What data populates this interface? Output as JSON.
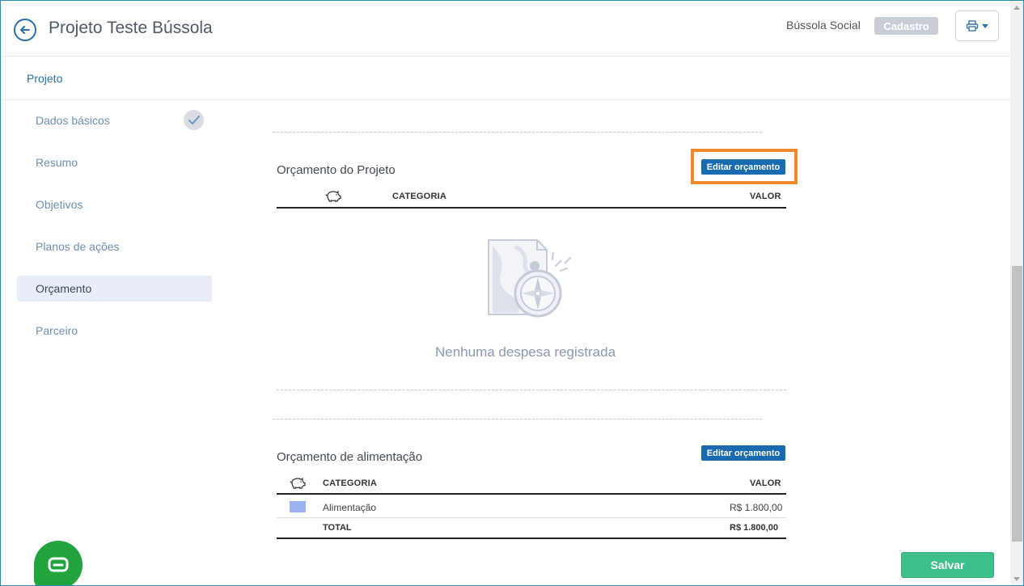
{
  "header": {
    "title": "Projeto Teste Bússola",
    "org_name": "Bússola Social",
    "status_badge": "Cadastro"
  },
  "subheader": {
    "title": "Projeto"
  },
  "sidebar": {
    "items": [
      {
        "label": "Dados básicos",
        "completed": true
      },
      {
        "label": "Resumo"
      },
      {
        "label": "Objetivos"
      },
      {
        "label": "Planos de ações"
      },
      {
        "label": "Orçamento",
        "active": true
      },
      {
        "label": "Parceiro"
      }
    ]
  },
  "budget_project": {
    "title": "Orçamento do Projeto",
    "edit_label": "Editar orçamento",
    "col_category": "CATEGORIA",
    "col_value": "VALOR",
    "empty_text": "Nenhuma despesa registrada"
  },
  "budget_food": {
    "title": "Orçamento de alimentação",
    "edit_label": "Editar orçamento",
    "col_category": "CATEGORIA",
    "col_value": "VALOR",
    "rows": [
      {
        "category": "Alimentação",
        "value": "R$ 1.800,00",
        "color": "#9db4f0"
      }
    ],
    "total_label": "TOTAL",
    "total_value": "R$ 1.800,00"
  },
  "actions": {
    "save_label": "Salvar"
  },
  "colors": {
    "primary": "#1a6ab0",
    "highlight": "#f28a2c",
    "save": "#3fbf8a",
    "chat": "#22a33b"
  },
  "icons": [
    "arrow-left-icon",
    "printer-icon",
    "chevron-down-icon",
    "check-icon",
    "piggy-bank-icon",
    "compass-map-icon",
    "chat-icon"
  ]
}
